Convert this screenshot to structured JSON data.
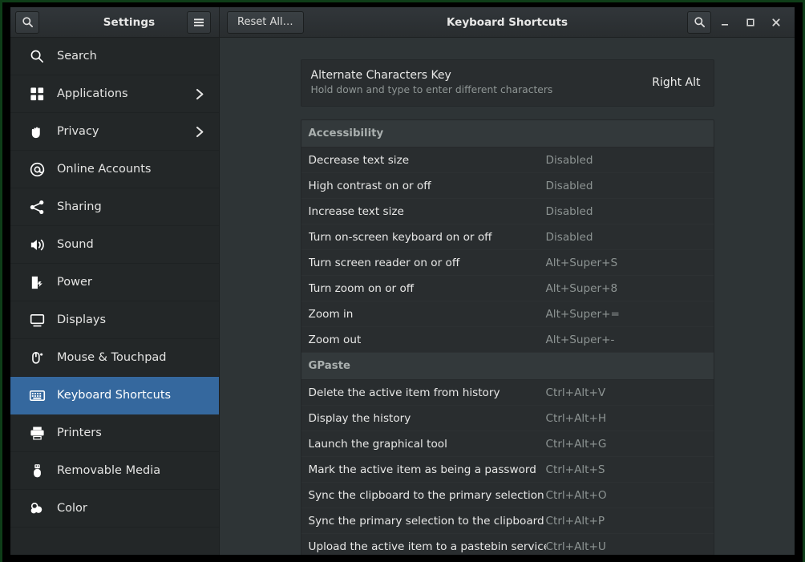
{
  "window": {
    "app_title": "Settings",
    "page_title": "Keyboard Shortcuts",
    "reset_all_label": "Reset All…",
    "icons": {
      "search_left": "search-icon",
      "menu": "hamburger-menu-icon",
      "search_right": "search-icon",
      "minimize": "minimize-icon",
      "maximize": "maximize-icon",
      "close": "close-icon"
    },
    "accent_color": "#35689e",
    "background_color": "#2e3436",
    "sidebar_color": "#232728",
    "card_color": "#292d2f"
  },
  "sidebar": {
    "items": [
      {
        "label": "Search",
        "icon": "search-icon",
        "chevron": "",
        "selected": false
      },
      {
        "label": "Applications",
        "icon": "grid-icon",
        "chevron": "›",
        "selected": false
      },
      {
        "label": "Privacy",
        "icon": "hand-icon",
        "chevron": "›",
        "selected": false
      },
      {
        "label": "Online Accounts",
        "icon": "at-sign-icon",
        "chevron": "",
        "selected": false
      },
      {
        "label": "Sharing",
        "icon": "share-icon",
        "chevron": "",
        "selected": false
      },
      {
        "label": "Sound",
        "icon": "speaker-icon",
        "chevron": "",
        "selected": false
      },
      {
        "label": "Power",
        "icon": "battery-icon",
        "chevron": "",
        "selected": false
      },
      {
        "label": "Displays",
        "icon": "monitor-icon",
        "chevron": "",
        "selected": false
      },
      {
        "label": "Mouse & Touchpad",
        "icon": "mouse-icon",
        "chevron": "",
        "selected": false
      },
      {
        "label": "Keyboard Shortcuts",
        "icon": "keyboard-icon",
        "chevron": "",
        "selected": true
      },
      {
        "label": "Printers",
        "icon": "printer-icon",
        "chevron": "",
        "selected": false
      },
      {
        "label": "Removable Media",
        "icon": "usb-drive-icon",
        "chevron": "",
        "selected": false
      },
      {
        "label": "Color",
        "icon": "color-disc-icon",
        "chevron": "",
        "selected": false
      }
    ]
  },
  "main": {
    "alternate_chars": {
      "title": "Alternate Characters Key",
      "subtitle": "Hold down and type to enter different characters",
      "value": "Right Alt"
    },
    "sections": [
      {
        "title": "Accessibility",
        "shortcuts": [
          {
            "name": "Decrease text size",
            "accel": "Disabled"
          },
          {
            "name": "High contrast on or off",
            "accel": "Disabled"
          },
          {
            "name": "Increase text size",
            "accel": "Disabled"
          },
          {
            "name": "Turn on-screen keyboard on or off",
            "accel": "Disabled"
          },
          {
            "name": "Turn screen reader on or off",
            "accel": "Alt+Super+S"
          },
          {
            "name": "Turn zoom on or off",
            "accel": "Alt+Super+8"
          },
          {
            "name": "Zoom in",
            "accel": "Alt+Super+="
          },
          {
            "name": "Zoom out",
            "accel": "Alt+Super+-"
          }
        ]
      },
      {
        "title": "GPaste",
        "shortcuts": [
          {
            "name": "Delete the active item from history",
            "accel": "Ctrl+Alt+V"
          },
          {
            "name": "Display the history",
            "accel": "Ctrl+Alt+H"
          },
          {
            "name": "Launch the graphical tool",
            "accel": "Ctrl+Alt+G"
          },
          {
            "name": "Mark the active item as being a password",
            "accel": "Ctrl+Alt+S"
          },
          {
            "name": "Sync the clipboard to the primary selection",
            "accel": "Ctrl+Alt+O"
          },
          {
            "name": "Sync the primary selection to the clipboard",
            "accel": "Ctrl+Alt+P"
          },
          {
            "name": "Upload the active item to a pastebin service",
            "accel": "Ctrl+Alt+U"
          }
        ]
      }
    ]
  }
}
